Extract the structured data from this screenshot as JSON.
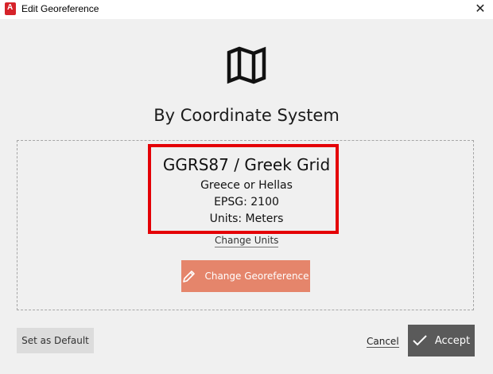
{
  "window": {
    "title": "Edit Georeference",
    "app_icon_letter": "A",
    "close_symbol": "✕"
  },
  "heading": "By Coordinate System",
  "coordinate_system": {
    "name": "GGRS87 / Greek Grid",
    "region": "Greece or Hellas",
    "epsg": "EPSG: 2100",
    "units": "Units: Meters"
  },
  "links": {
    "change_units": "Change Units",
    "cancel": "Cancel"
  },
  "buttons": {
    "change_georeference": "Change Georeference",
    "set_as_default": "Set as Default",
    "accept": "Accept"
  },
  "colors": {
    "highlight_border": "#e40006",
    "change_button": "#e5856b",
    "accept_button": "#5a5a5a"
  },
  "icons": {
    "header": "map-icon",
    "change_georeference": "pencil-icon",
    "accept": "checkmark-icon"
  }
}
